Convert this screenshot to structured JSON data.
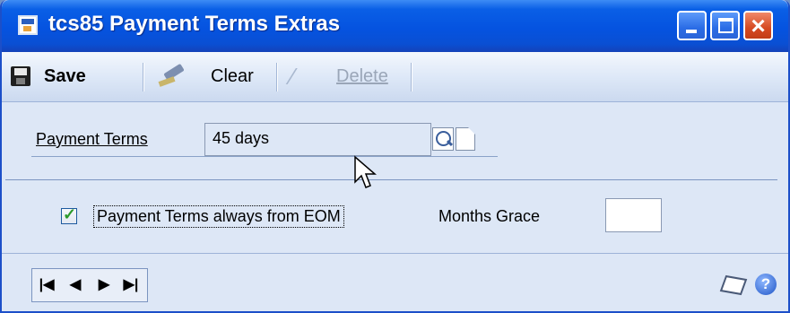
{
  "window": {
    "title": "tcs85 Payment Terms Extras"
  },
  "toolbar": {
    "save_label": "Save",
    "clear_label": "Clear",
    "delete_label": "Delete"
  },
  "form": {
    "payment_terms_label": "Payment Terms",
    "payment_terms_value": "45 days",
    "eom_checked": true,
    "eom_label": "Payment Terms always from EOM",
    "months_grace_label": "Months Grace",
    "months_grace_value": ""
  },
  "icons": {
    "app": "window-app-icon",
    "save": "save-icon",
    "clear": "eraser-icon",
    "delete": "delete-icon",
    "lookup": "magnifier-icon",
    "new": "new-document-icon",
    "note": "note-icon",
    "help": "help-icon"
  },
  "navigation": {
    "first": "|◀",
    "previous": "◀",
    "next": "▶",
    "last": "▶|"
  },
  "colors": {
    "titlebar": "#0553e0",
    "window_bg": "#dde7f6",
    "close": "#d64a22"
  }
}
